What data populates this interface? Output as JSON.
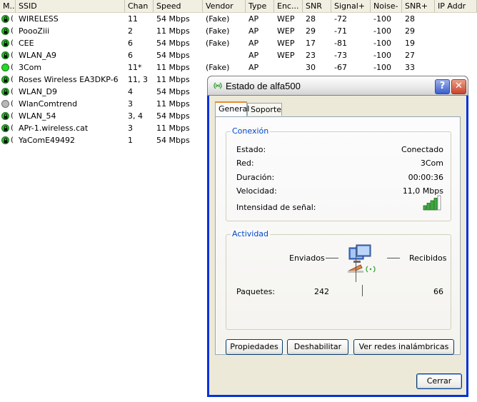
{
  "list": {
    "columns": [
      "M..",
      "SSID",
      "Chan",
      "Speed",
      "Vendor",
      "Type",
      "Enc...",
      "SNR",
      "Signal+",
      "Noise-",
      "SNR+",
      "IP Addr"
    ],
    "rows": [
      {
        "status": "green-lock",
        "ssid": "WIRELESS",
        "chan": "11",
        "speed": "54 Mbps",
        "vendor": "(Fake)",
        "type": "AP",
        "enc": "WEP",
        "snr": "28",
        "signal": "-72",
        "noise": "-100",
        "snrplus": "28"
      },
      {
        "status": "green-lock",
        "ssid": "PoooZiii",
        "chan": "2",
        "speed": "11 Mbps",
        "vendor": "(Fake)",
        "type": "AP",
        "enc": "WEP",
        "snr": "29",
        "signal": "-71",
        "noise": "-100",
        "snrplus": "29"
      },
      {
        "status": "green-lock",
        "ssid": "CEE",
        "chan": "6",
        "speed": "54 Mbps",
        "vendor": "(Fake)",
        "type": "AP",
        "enc": "WEP",
        "snr": "17",
        "signal": "-81",
        "noise": "-100",
        "snrplus": "19"
      },
      {
        "status": "green-lock",
        "ssid": "WLAN_A9",
        "chan": "6",
        "speed": "54 Mbps",
        "vendor": "",
        "type": "AP",
        "enc": "WEP",
        "snr": "23",
        "signal": "-73",
        "noise": "-100",
        "snrplus": "27"
      },
      {
        "status": "green",
        "ssid": "3Com",
        "chan": "11*",
        "speed": "11 Mbps",
        "vendor": "(Fake)",
        "type": "AP",
        "enc": "",
        "snr": "30",
        "signal": "-67",
        "noise": "-100",
        "snrplus": "33"
      },
      {
        "status": "green-lock",
        "ssid": "Roses Wireless EA3DKP-6",
        "chan": "11, 3",
        "speed": "11 Mbps",
        "vendor": "",
        "type": "",
        "enc": "",
        "snr": "",
        "signal": "",
        "noise": "",
        "snrplus": ""
      },
      {
        "status": "green-lock",
        "ssid": "WLAN_D9",
        "chan": "4",
        "speed": "54 Mbps",
        "vendor": "",
        "type": "",
        "enc": "",
        "snr": "",
        "signal": "",
        "noise": "",
        "snrplus": ""
      },
      {
        "status": "gray",
        "ssid": "WlanComtrend",
        "chan": "3",
        "speed": "11 Mbps",
        "vendor": "",
        "type": "",
        "enc": "",
        "snr": "",
        "signal": "",
        "noise": "",
        "snrplus": ""
      },
      {
        "status": "green-lock",
        "ssid": "WLAN_54",
        "chan": "3, 4",
        "speed": "54 Mbps",
        "vendor": "",
        "type": "",
        "enc": "",
        "snr": "",
        "signal": "",
        "noise": "",
        "snrplus": ""
      },
      {
        "status": "green-lock",
        "ssid": "APr-1.wireless.cat",
        "chan": "3",
        "speed": "11 Mbps",
        "vendor": "",
        "type": "",
        "enc": "",
        "snr": "",
        "signal": "",
        "noise": "",
        "snrplus": ""
      },
      {
        "status": "green-lock",
        "ssid": "YaComE49492",
        "chan": "1",
        "speed": "54 Mbps",
        "vendor": "",
        "type": "",
        "enc": "",
        "snr": "",
        "signal": "",
        "noise": "",
        "snrplus": ""
      }
    ]
  },
  "dialog": {
    "title": "Estado de alfa500",
    "help_label": "?",
    "close_glyph": "✕",
    "tabs": [
      "General",
      "Soporte"
    ],
    "connection": {
      "title": "Conexión",
      "status_label": "Estado:",
      "status_value": "Conectado",
      "network_label": "Red:",
      "network_value": "3Com",
      "duration_label": "Duración:",
      "duration_value": "00:00:36",
      "speed_label": "Velocidad:",
      "speed_value": "11,0 Mbps",
      "signal_label": "Intensidad de señal:",
      "signal_bars_lit": 4,
      "signal_bars_total": 5
    },
    "activity": {
      "title": "Actividad",
      "sent_label": "Enviados",
      "received_label": "Recibidos",
      "packets_label": "Paquetes:",
      "packets_sent": "242",
      "packets_received": "66"
    },
    "buttons": {
      "properties": "Propiedades",
      "disable": "Deshabilitar",
      "view_networks": "Ver redes inalámbricas",
      "close": "Cerrar"
    }
  },
  "colors": {
    "accent": "#0046d5",
    "signal_green": "#3fae3f",
    "tab_highlight": "#e68b2c"
  }
}
